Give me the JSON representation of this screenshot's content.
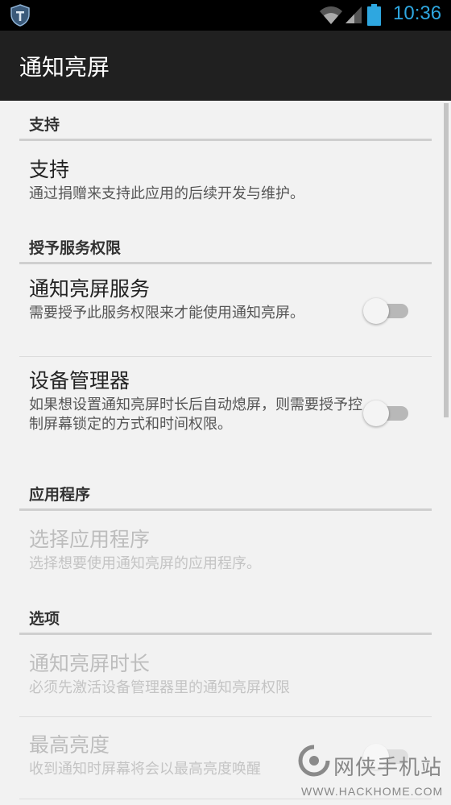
{
  "status_bar": {
    "time": "10:36",
    "icons": [
      "shield-icon",
      "wifi-icon",
      "signal-icon",
      "battery-icon"
    ],
    "clock_color": "#2ea7e0"
  },
  "action_bar": {
    "title": "通知亮屏"
  },
  "sections": [
    {
      "header": "支持",
      "items": [
        {
          "title": "支持",
          "summary": "通过捐赠来支持此应用的后续开发与维护。",
          "enabled": true
        }
      ]
    },
    {
      "header": "授予服务权限",
      "items": [
        {
          "title": "通知亮屏服务",
          "summary": "需要授予此服务权限来才能使用通知亮屏。",
          "enabled": true,
          "switch": false
        },
        {
          "title": "设备管理器",
          "summary": "如果想设置通知亮屏时长后自动熄屏，则需要授予控制屏幕锁定的方式和时间权限。",
          "enabled": true,
          "switch": false
        }
      ]
    },
    {
      "header": "应用程序",
      "items": [
        {
          "title": "选择应用程序",
          "summary": "选择想要使用通知亮屏的应用程序。",
          "enabled": false
        }
      ]
    },
    {
      "header": "选项",
      "items": [
        {
          "title": "通知亮屏时长",
          "summary": "必须先激活设备管理器里的通知亮屏权限",
          "enabled": false
        },
        {
          "title": "最高亮度",
          "summary": "收到通知时屏幕将会以最高亮度唤醒",
          "enabled": false,
          "switch": false
        }
      ]
    }
  ],
  "watermark": {
    "name": "网侠手机站",
    "url": "WWW.HACKHOME.COM"
  }
}
